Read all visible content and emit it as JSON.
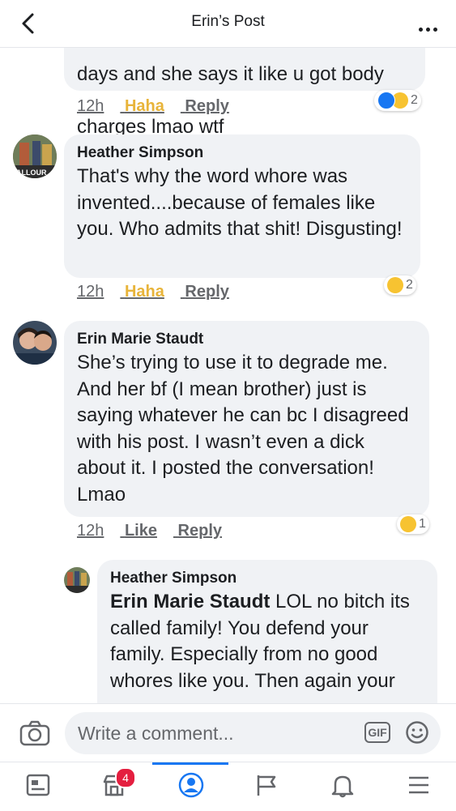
{
  "header": {
    "title": "Erin’s Post"
  },
  "comments": [
    {
      "text_partial_top": "days and she says it like u got body",
      "text_tail": "charges lmao wtf",
      "time": "12h",
      "reaction": "Haha",
      "reply": "Reply",
      "reaction_count": "2"
    },
    {
      "author": "Heather Simpson",
      "text": "That's why the word whore was invented....because of females like you. Who admits that shit! Disgusting!",
      "time": "12h",
      "reaction": "Haha",
      "reply": "Reply",
      "reaction_count": "2",
      "avatar_label": "ALLOUR"
    },
    {
      "author": "Erin Marie Staudt",
      "text": "She’s trying to use it to degrade me. And her bf (I mean brother) just is saying whatever he can bc I disagreed with his post. I wasn’t even a dick about it. I posted the conversation! Lmao",
      "time": "12h",
      "reaction": "Like",
      "reply": "Reply",
      "reaction_count": "1"
    },
    {
      "author": "Heather Simpson",
      "mention": "Erin Marie Staudt",
      "text": " LOL no bitch its called family! You defend your family. Especially from no good whores like you. Then again your",
      "avatar_label": "ALLOUR"
    }
  ],
  "composer": {
    "placeholder": "Write a comment...",
    "gif_label": "GIF"
  },
  "tabbar": {
    "notifications_badge": "4"
  },
  "icons": [
    "back-chevron-icon",
    "more-icon",
    "camera-icon",
    "gif-icon",
    "emoji-icon",
    "news-feed-icon",
    "marketplace-icon",
    "profile-icon",
    "pages-flag-icon",
    "bell-icon",
    "menu-icon"
  ],
  "colors": {
    "accent": "#1877f2",
    "haha": "#e8b43a",
    "bubble": "#f0f2f5",
    "badge": "#e41e3f"
  }
}
